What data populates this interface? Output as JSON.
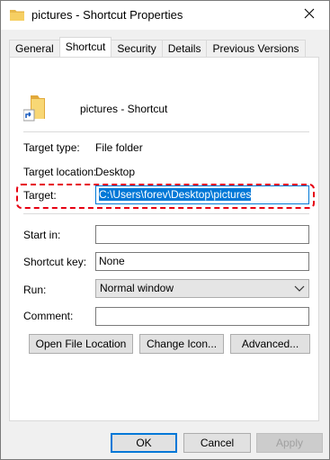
{
  "window": {
    "title": "pictures - Shortcut Properties",
    "close_icon": "close-icon"
  },
  "tabs": [
    {
      "label": "General",
      "active": false
    },
    {
      "label": "Shortcut",
      "active": true
    },
    {
      "label": "Security",
      "active": false
    },
    {
      "label": "Details",
      "active": false
    },
    {
      "label": "Previous Versions",
      "active": false
    }
  ],
  "shortcut": {
    "name": "pictures - Shortcut",
    "icon": "folder-shortcut-icon"
  },
  "fields": {
    "target_type_label": "Target type:",
    "target_type_value": "File folder",
    "target_location_label": "Target location:",
    "target_location_value": "Desktop",
    "target_label": "Target:",
    "target_value": "C:\\Users\\forev\\Desktop\\pictures",
    "start_in_label": "Start in:",
    "start_in_value": "",
    "shortcut_key_label": "Shortcut key:",
    "shortcut_key_value": "None",
    "run_label": "Run:",
    "run_value": "Normal window",
    "comment_label": "Comment:",
    "comment_value": ""
  },
  "buttons": {
    "open_file_location": "Open File Location",
    "change_icon": "Change Icon...",
    "advanced": "Advanced...",
    "ok": "OK",
    "cancel": "Cancel",
    "apply": "Apply"
  },
  "colors": {
    "selection": "#0078d7",
    "highlight_border": "#e60012"
  }
}
